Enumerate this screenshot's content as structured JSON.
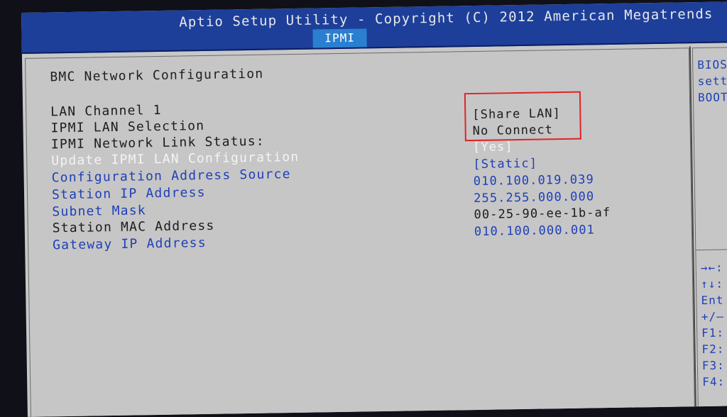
{
  "header": {
    "title": "Aptio Setup Utility - Copyright (C) 2012 American Megatrends",
    "active_tab": "IPMI"
  },
  "main": {
    "heading": "BMC Network Configuration",
    "rows": [
      {
        "label": "LAN Channel 1",
        "value": ""
      },
      {
        "label": "IPMI LAN Selection",
        "value": "[Share LAN]"
      },
      {
        "label": "IPMI Network Link Status:",
        "value": "No Connect"
      },
      {
        "label": "Update IPMI LAN Configuration",
        "value": "[Yes]"
      },
      {
        "label": "Configuration Address Source",
        "value": "[Static]"
      },
      {
        "label": "Station IP Address",
        "value": "010.100.019.039"
      },
      {
        "label": "Subnet Mask",
        "value": "255.255.000.000"
      },
      {
        "label": "Station MAC Address",
        "value": "00-25-90-ee-1b-af"
      },
      {
        "label": "Gateway IP Address",
        "value": "010.100.000.001"
      }
    ]
  },
  "help_panel": {
    "lines": [
      "BIOS",
      "sett",
      "BOOT"
    ],
    "keys": [
      "→←:",
      "↑↓:",
      "Ent",
      "+/–",
      "F1:",
      "F2:",
      "F3:",
      "F4:"
    ]
  },
  "colors": {
    "header_bg": "#1d3f9a",
    "tab_bg": "#2b7fd0",
    "panel_bg": "#c6c6c6",
    "selectable_text": "#1f3fb8",
    "highlight_box": "#e02424"
  }
}
